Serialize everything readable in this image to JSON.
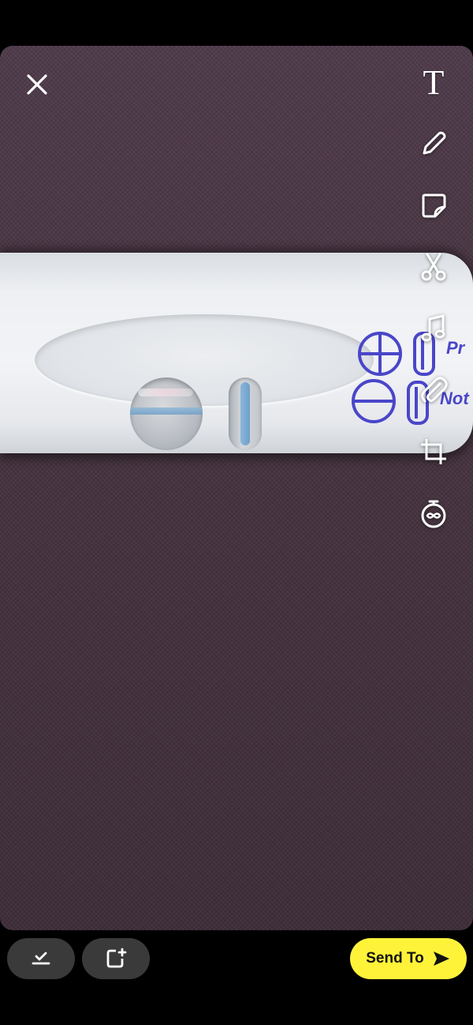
{
  "app": {
    "close_icon": "close-icon"
  },
  "toolbar": {
    "items": [
      {
        "name": "text-tool-icon",
        "label": "T"
      },
      {
        "name": "pencil-icon"
      },
      {
        "name": "sticker-icon"
      },
      {
        "name": "scissors-icon"
      },
      {
        "name": "music-note-icon"
      },
      {
        "name": "paperclip-icon"
      },
      {
        "name": "crop-icon"
      },
      {
        "name": "timer-icon"
      }
    ]
  },
  "photo": {
    "key_text_top": "Pr",
    "key_text_bottom": "Not"
  },
  "bottom": {
    "save_icon": "download-check-icon",
    "story_icon": "add-story-icon",
    "send_label": "Send To",
    "send_icon": "send-arrow-icon",
    "accent_color": "#fff33a"
  }
}
